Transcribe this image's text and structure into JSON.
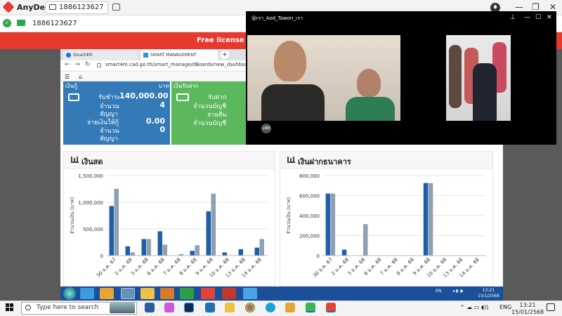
{
  "anydesk": {
    "app_name": "AnyDesk",
    "tab_id": "1886123627",
    "address": "1886123627",
    "banner": "Free license (non-",
    "icon_badge": "♦"
  },
  "browser": {
    "tabs": [
      {
        "label": "Smart4M"
      },
      {
        "label": "SMART MANAGEMENT"
      }
    ],
    "url": "smart4m.cad.go.th/smart_manage/dBoards/new_dashboard.php?mob"
  },
  "cards": {
    "blue": {
      "head_left": "เงินกู้",
      "head_right": "บาท",
      "row1_label": "รับชำระ",
      "row1_value": "140,000.00",
      "row2_label": "จำนวน",
      "row2_sub": "สัญญา",
      "row2_value": "4",
      "row3_label": "จ่ายเงินให้กู้",
      "row3_value": "0.00",
      "row4_label": "จำนวน",
      "row4_sub": "สัญญา",
      "row4_value": "0"
    },
    "green": {
      "head_left": "เงินรับฝาก",
      "row1_label": "รับฝาก",
      "row2_label": "จำนวนบัญชี",
      "row3_label": "จ่ายคืน",
      "row4_label": "จำนวนบัญชี"
    }
  },
  "video": {
    "title": "@เรา_Aod_Tawon_เรา",
    "line_label": "LINE"
  },
  "remote_taskbar": {
    "lang": "EN",
    "time": "13:21",
    "date": "15/1/2568"
  },
  "win_taskbar": {
    "search_placeholder": "Type here to search",
    "lang": "ENG",
    "time": "13:21",
    "date": "15/01/2568"
  },
  "chart_data": [
    {
      "type": "bar",
      "title": "เงินสด",
      "ylabel": "จำนวนเงิน (บาท)",
      "ylim": [
        0,
        1500000
      ],
      "yticks": [
        "0",
        "500,000",
        "1,000,000",
        "1,500,000"
      ],
      "categories": [
        "30 ธ.ค. 67",
        "2 ม.ค. 68",
        "3 ม.ค. 68",
        "6 ม.ค. 68",
        "7 ม.ค. 68",
        "8 ม.ค. 68",
        "9 ม.ค. 68",
        "10 ม.ค. 68",
        "13 ม.ค. 68",
        "14 ม.ค. 68"
      ],
      "series": [
        {
          "color": "#1f5fa8",
          "values": [
            930000,
            175000,
            310000,
            455000,
            0,
            90000,
            830000,
            60000,
            120000,
            150000
          ]
        },
        {
          "color": "#8ea0b3",
          "values": [
            1250000,
            60000,
            310000,
            205000,
            30000,
            195000,
            1160000,
            0,
            0,
            310000
          ]
        }
      ]
    },
    {
      "type": "bar",
      "title": "เงินฝากธนาคาร",
      "ylabel": "จำนวนเงิน (บาท)",
      "ylim": [
        0,
        800000
      ],
      "yticks": [
        "0",
        "200,000",
        "400,000",
        "600,000",
        "800,000"
      ],
      "categories": [
        "30 ธ.ค. 67",
        "2 ม.ค. 68",
        "3 ม.ค. 68",
        "6 ม.ค. 68",
        "7 ม.ค. 68",
        "8 ม.ค. 68",
        "9 ม.ค. 68",
        "10 ม.ค. 68",
        "13 ม.ค. 68",
        "14 ม.ค. 68"
      ],
      "series": [
        {
          "color": "#1f5fa8",
          "values": [
            620000,
            60000,
            0,
            0,
            0,
            0,
            725000,
            0,
            0,
            0
          ]
        },
        {
          "color": "#8ea0b3",
          "values": [
            620000,
            0,
            315000,
            0,
            0,
            0,
            725000,
            0,
            0,
            0
          ]
        }
      ]
    }
  ]
}
